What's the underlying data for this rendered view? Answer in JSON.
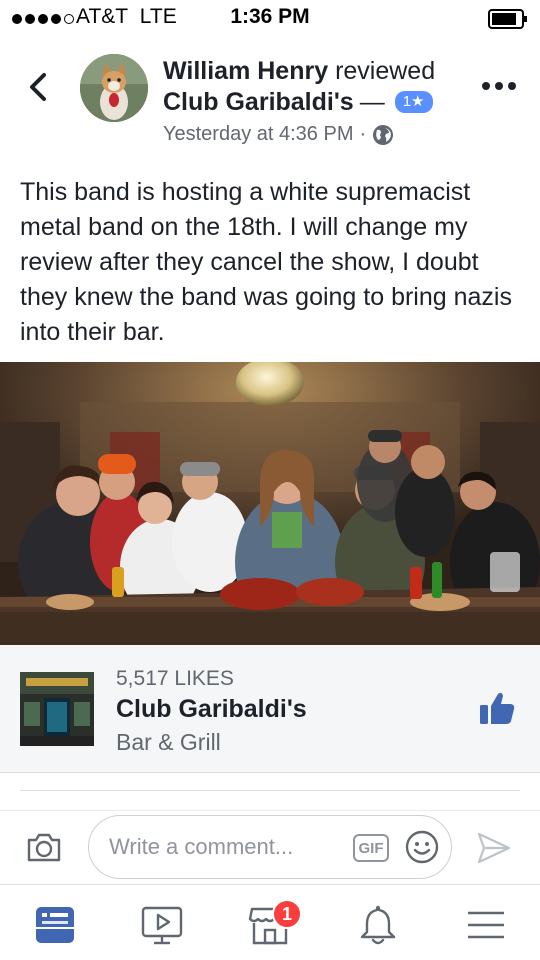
{
  "status_bar": {
    "carrier": "AT&T",
    "network": "LTE",
    "time": "1:36 PM",
    "signal_bars": 4
  },
  "header": {
    "author": "William Henry",
    "action": "reviewed",
    "page": "Club Garibaldi's",
    "dash": "—",
    "rating": "1★",
    "timestamp": "Yesterday at 4:36 PM",
    "separator": "·",
    "privacy_icon": "globe-icon"
  },
  "post": {
    "text": "This band is hosting a white supremacist metal band on the 18th. I will change my review after they cancel the show, I doubt they knew the band was going to bring nazis into their bar."
  },
  "page_card": {
    "likes": "5,517 LIKES",
    "name": "Club Garibaldi's",
    "category": "Bar & Grill"
  },
  "comment_bar": {
    "placeholder": "Write a comment...",
    "gif_label": "GIF"
  },
  "bottom_nav": {
    "items": [
      "news-feed-icon",
      "video-icon",
      "marketplace-icon",
      "notifications-icon",
      "menu-icon"
    ],
    "marketplace_badge": "1"
  },
  "colors": {
    "accent": "#4267b2",
    "rating_badge": "#5890ff",
    "notification_badge": "#fa3e3e",
    "secondary_text": "#616770"
  }
}
